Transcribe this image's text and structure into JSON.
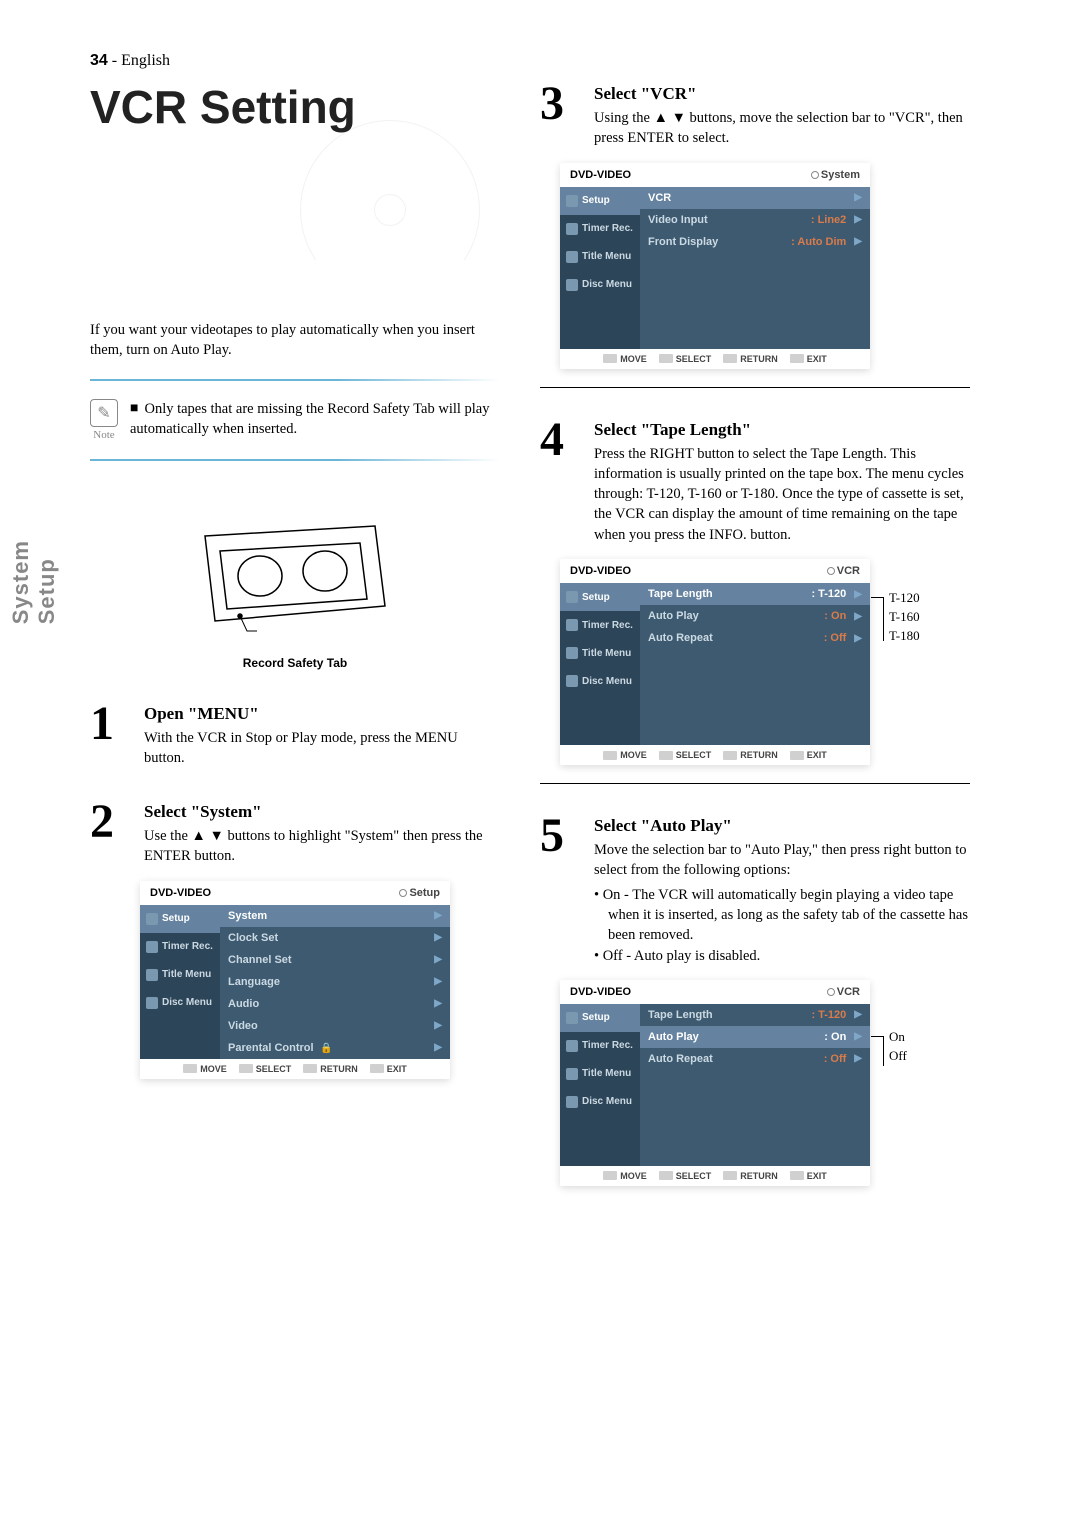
{
  "side_tab": "System Setup",
  "title": "VCR Setting",
  "intro": "If you want your videotapes to play automatically when you insert them, turn on Auto Play.",
  "note": {
    "label": "Note",
    "text": "Only tapes that are missing the Record Safety  Tab will play automatically when inserted."
  },
  "cassette_caption": "Record Safety Tab",
  "steps": {
    "s1": {
      "num": "1",
      "title": "Open \"MENU\"",
      "text": "With the VCR in Stop or Play mode, press the MENU button."
    },
    "s2": {
      "num": "2",
      "title": "Select \"System\"",
      "text": "Use the ▲ ▼ buttons to highlight \"System\" then press the ENTER button."
    },
    "s3": {
      "num": "3",
      "title": "Select \"VCR\"",
      "text": "Using the ▲ ▼ buttons, move the selection bar to \"VCR\", then press ENTER to select."
    },
    "s4": {
      "num": "4",
      "title": "Select \"Tape Length\"",
      "text": "Press the RIGHT button to select the Tape Length. This information is usually printed on the tape box. The menu cycles through: T-120, T-160 or T-180. Once the type of cassette is set, the VCR can display the amount of time remaining on the tape when you press the INFO. button."
    },
    "s5": {
      "num": "5",
      "title": "Select \"Auto Play\"",
      "text_intro": "Move the selection bar to \"Auto Play,\" then press right button to select from the following options:",
      "li1": "• On - The VCR will automatically begin playing a video tape when it is inserted, as long as the safety tab of the cassette has been removed.",
      "li2": "• Off - Auto play is disabled."
    }
  },
  "osd_common": {
    "header": "DVD-VIDEO",
    "side": [
      "Setup",
      "Timer Rec.",
      "Title Menu",
      "Disc Menu"
    ],
    "foot": [
      "MOVE",
      "SELECT",
      "RETURN",
      "EXIT"
    ]
  },
  "osd2": {
    "breadcrumb": "Setup",
    "rows": [
      {
        "label": "System",
        "hi": true
      },
      {
        "label": "Clock Set"
      },
      {
        "label": "Channel Set"
      },
      {
        "label": "Language"
      },
      {
        "label": "Audio"
      },
      {
        "label": "Video"
      },
      {
        "label": "Parental Control",
        "lock": true
      }
    ]
  },
  "osd3": {
    "breadcrumb": "System",
    "rows": [
      {
        "label": "VCR",
        "hi": true
      },
      {
        "label": "Video Input",
        "val": ": Line2"
      },
      {
        "label": "Front Display",
        "val": ": Auto Dim"
      }
    ]
  },
  "osd4": {
    "breadcrumb": "VCR",
    "rows": [
      {
        "label": "Tape Length",
        "val": ": T-120",
        "hi": true
      },
      {
        "label": "Auto Play",
        "val": ": On"
      },
      {
        "label": "Auto Repeat",
        "val": ": Off"
      }
    ],
    "annotation": [
      "T-120",
      "T-160",
      "T-180"
    ]
  },
  "osd5": {
    "breadcrumb": "VCR",
    "rows": [
      {
        "label": "Tape Length",
        "val": ": T-120"
      },
      {
        "label": "Auto Play",
        "val": ": On",
        "hi": true
      },
      {
        "label": "Auto Repeat",
        "val": ": Off"
      }
    ],
    "annotation": [
      "On",
      "Off"
    ]
  },
  "page_number": "34",
  "page_lang": "English"
}
